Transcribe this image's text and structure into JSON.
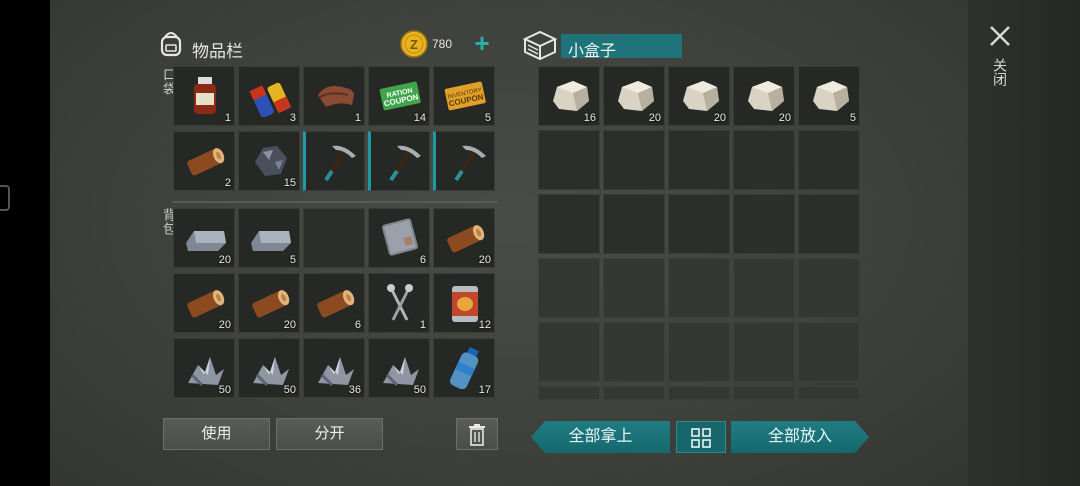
{
  "inventory": {
    "title": "物品栏",
    "coins": "780",
    "pocket_label": "口袋",
    "backpack_label": "背包",
    "pocket": [
      {
        "icon": "medicine-bottle",
        "count": "1"
      },
      {
        "icon": "batteries",
        "count": "3"
      },
      {
        "icon": "leather",
        "count": "1"
      },
      {
        "icon": "green-coupon",
        "count": "14"
      },
      {
        "icon": "gold-coupon",
        "count": "5"
      },
      {
        "icon": "wood-log",
        "count": "2"
      },
      {
        "icon": "iron-ore",
        "count": "15"
      },
      {
        "icon": "pickaxe",
        "count": ""
      },
      {
        "icon": "pickaxe",
        "count": ""
      },
      {
        "icon": "pickaxe",
        "count": ""
      }
    ],
    "backpack": [
      {
        "icon": "iron-ingot",
        "count": "20"
      },
      {
        "icon": "iron-ingot",
        "count": "5"
      },
      {
        "icon": "empty",
        "count": ""
      },
      {
        "icon": "metal-plate",
        "count": "6"
      },
      {
        "icon": "wood-log",
        "count": "20"
      },
      {
        "icon": "wood-log",
        "count": "20"
      },
      {
        "icon": "wood-log",
        "count": "20"
      },
      {
        "icon": "wood-log",
        "count": "6"
      },
      {
        "icon": "nails",
        "count": "1"
      },
      {
        "icon": "canned-food",
        "count": "12"
      },
      {
        "icon": "scrap-metal",
        "count": "50"
      },
      {
        "icon": "scrap-metal",
        "count": "50"
      },
      {
        "icon": "scrap-metal",
        "count": "36"
      },
      {
        "icon": "scrap-metal",
        "count": "50"
      },
      {
        "icon": "water-bottle",
        "count": "17"
      }
    ],
    "use_label": "使用",
    "split_label": "分开"
  },
  "box": {
    "title": "小盒子",
    "items": [
      {
        "icon": "stone",
        "count": "16"
      },
      {
        "icon": "stone",
        "count": "20"
      },
      {
        "icon": "stone",
        "count": "20"
      },
      {
        "icon": "stone",
        "count": "20"
      },
      {
        "icon": "stone",
        "count": "5"
      }
    ],
    "take_all_label": "全部拿上",
    "put_all_label": "全部放入"
  },
  "close_label": "关闭",
  "colors": {
    "accent": "#1e9aa5",
    "button_teal": "#1b7479",
    "coin": "#e9b21f",
    "plus": "#27b3a9"
  }
}
